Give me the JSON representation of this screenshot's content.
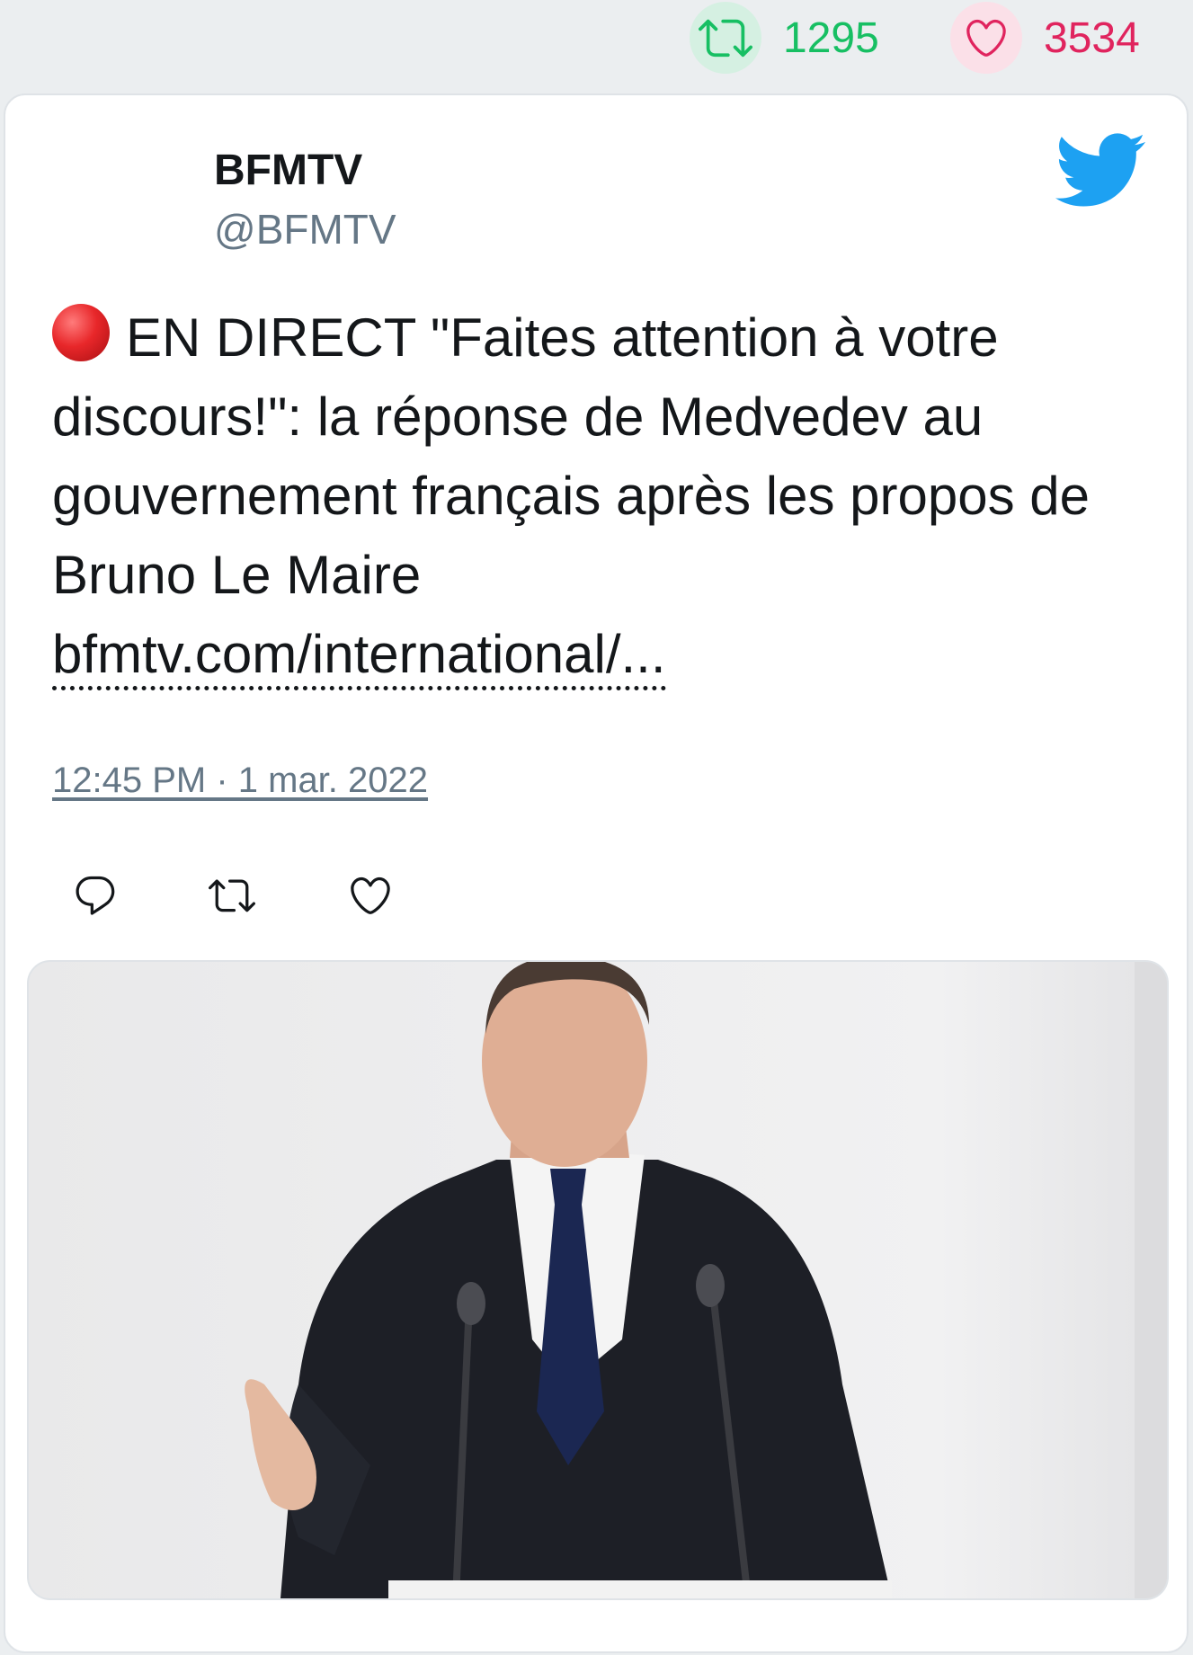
{
  "stats": {
    "retweets": "1295",
    "likes": "3534",
    "retweet_icon": "retweet-icon",
    "like_icon": "heart-icon"
  },
  "tweet": {
    "display_name": "BFMTV",
    "handle": "@BFMTV",
    "live_emoji": "red-circle",
    "text": "EN DIRECT \"Faites attention à votre discours!\": la réponse de Medvedev au gouvernement français après les propos de Bruno Le Maire",
    "link": "bfmtv.com/international/...",
    "timestamp": "12:45 PM · 1 mar. 2022",
    "actions": [
      "reply-icon",
      "retweet-icon",
      "heart-icon"
    ]
  },
  "colors": {
    "retweet_green": "#17bf63",
    "like_red": "#e0245e",
    "twitter_blue": "#1da1f2",
    "muted_gray": "#657786"
  }
}
